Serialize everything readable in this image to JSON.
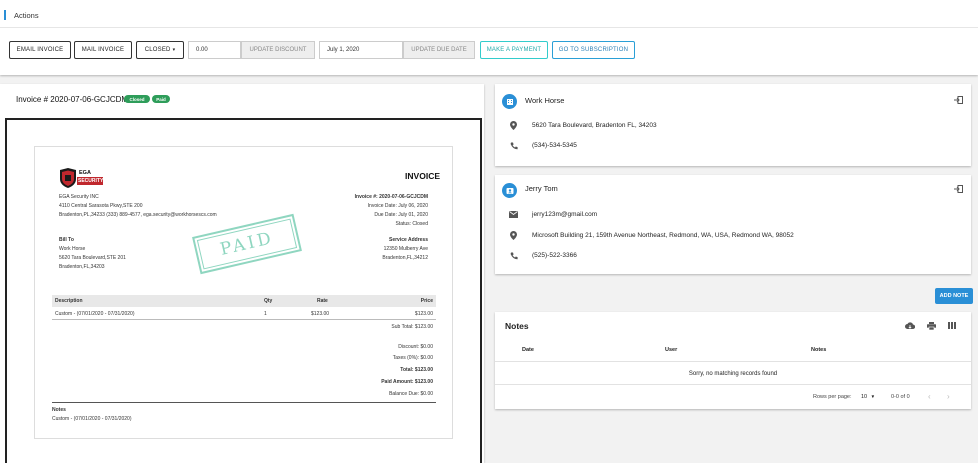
{
  "actions": {
    "title": "Actions",
    "email_invoice": "EMAIL INVOICE",
    "mail_invoice": "MAIL INVOICE",
    "status_select": "CLOSED",
    "discount_value": "0.00",
    "update_discount": "UPDATE DISCOUNT",
    "due_date_value": "July 1, 2020",
    "update_due_date": "UPDATE DUE DATE",
    "make_payment": "MAKE A PAYMENT",
    "go_to_subscription": "GO TO SUBSCRIPTION"
  },
  "invoice": {
    "header": "Invoice # 2020-07-06-GCJCDM",
    "badges": [
      "Closed",
      "Paid"
    ],
    "logo_text": [
      "EGA",
      "SECURITY"
    ],
    "doc_title": "INVOICE",
    "company": [
      "EGA Security INC",
      "4110 Central Sarasota Pkwy,STE 200",
      "Bradenton,PL,34233 (333) 889-4577, ega.security@workhorsescs.com"
    ],
    "invoice_no": "Invoice #: 2020-07-06-GCJCDM",
    "invoice_date": "Invoice Date: July 06, 2020",
    "due_date": "Due Date: July 01, 2020",
    "status": "Status: Closed",
    "stamp": "PAID",
    "bill_to_label": "Bill To",
    "bill_to": [
      "Work Horse",
      "5620 Tara Boulevard,STE 201",
      "Bradenton,FL,34203"
    ],
    "service_label": "Service Address",
    "service": [
      "12350 Mulberry Ave",
      "Bradenton,FL,34212"
    ],
    "table_headers": [
      "Description",
      "Qty",
      "Rate",
      "Price"
    ],
    "rows": [
      {
        "description": "Custom - (07/01/2020 - 07/31/2020)",
        "qty": "1",
        "rate": "$123.00",
        "price": "$123.00"
      }
    ],
    "sub_total": "Sub Total: $123.00",
    "discount": "Discount: $0.00",
    "taxes": "Taxes (0%): $0.00",
    "total": "Total: $123.00",
    "paid_amount": "Paid Amount: $123.00",
    "balance_due": "Balance Due: $0.00",
    "notes_label": "Notes",
    "notes": "Custom - (07/01/2020 - 07/31/2020)"
  },
  "customer": {
    "name": "Work Horse",
    "address": "5620 Tara Boulevard, Bradenton FL, 34203",
    "phone": "(534)-534-5345"
  },
  "contact": {
    "name": "Jerry Tom",
    "email": "jerry123m@gmail.com",
    "address": "Microsoft Building 21, 159th Avenue Northeast, Redmond, WA, USA, Redmond WA, 98052",
    "phone": "(525)-522-3366"
  },
  "notes_panel": {
    "add_note": "ADD NOTE",
    "title": "Notes",
    "columns": [
      "Date",
      "User",
      "Notes"
    ],
    "empty": "Sorry, no matching records found",
    "rows_per_page_label": "Rows per page:",
    "rows_per_page": "10",
    "range": "0-0 of 0"
  },
  "colors": {
    "accent": "#2a8fd6",
    "badge_green": "#2e9d5a",
    "teal": "#33cccc",
    "stamp": "#8fd6c0"
  }
}
